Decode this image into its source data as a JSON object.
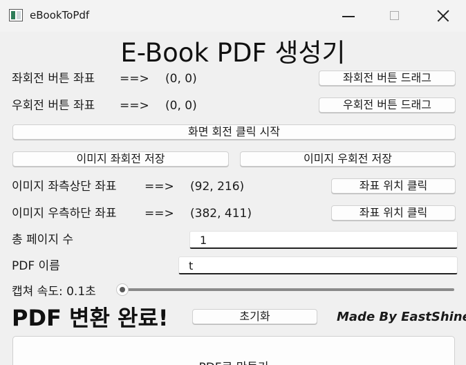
{
  "window": {
    "title": "eBookToPdf"
  },
  "heading": "E-Book PDF 생성기",
  "rotate_left": {
    "label": "좌회전 버튼 좌표",
    "arrow": "==>",
    "coords": "(0, 0)",
    "button": "좌회전 버튼 드래그"
  },
  "rotate_right": {
    "label": "우회전 버튼 좌표",
    "arrow": "==>",
    "coords": "(0, 0)",
    "button": "우회전 버튼 드래그"
  },
  "screen_rotate_button": "화면 회전 클릭 시작",
  "save_left_button": "이미지 좌회전 저장",
  "save_right_button": "이미지 우회전 저장",
  "top_left": {
    "label": "이미지 좌측상단 좌표",
    "arrow": "==>",
    "coords": "(92, 216)",
    "button": "좌표 위치 클릭"
  },
  "bottom_right": {
    "label": "이미지 우측하단 좌표",
    "arrow": "==>",
    "coords": "(382, 411)",
    "button": "좌표 위치 클릭"
  },
  "total_pages": {
    "label": "총 페이지 수",
    "value": "1"
  },
  "pdf_name": {
    "label": "PDF 이름",
    "value": "t"
  },
  "capture_speed": {
    "label": "캡쳐 속도: 0.1초",
    "level": 0
  },
  "status_text": "PDF 변환 완료!",
  "reset_button": "초기화",
  "made_by": "Made By EastShine",
  "make_pdf_button": "PDF로 만들기"
}
